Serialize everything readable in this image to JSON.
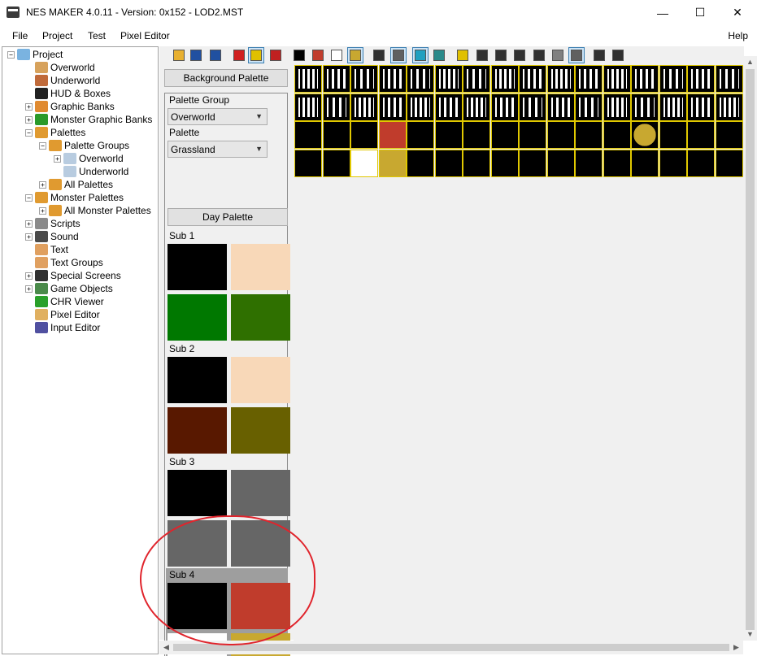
{
  "window": {
    "title": "NES MAKER 4.0.11 - Version: 0x152 - LOD2.MST",
    "min_glyph": "—",
    "max_glyph": "☐",
    "close_glyph": "✕"
  },
  "menu": {
    "items": [
      "File",
      "Project",
      "Test",
      "Pixel Editor"
    ],
    "help": "Help"
  },
  "tree": {
    "items": [
      {
        "label": "Project",
        "level": 0,
        "expander": "−",
        "icon": "project-icon",
        "color": "#7ab3e0"
      },
      {
        "label": "Overworld",
        "level": 1,
        "expander": "",
        "icon": "overworld-icon",
        "color": "#d7a25c"
      },
      {
        "label": "Underworld",
        "level": 1,
        "expander": "",
        "icon": "underworld-icon",
        "color": "#c06a3a"
      },
      {
        "label": "HUD & Boxes",
        "level": 1,
        "expander": "",
        "icon": "hud-icon",
        "color": "#222222"
      },
      {
        "label": "Graphic Banks",
        "level": 1,
        "expander": "+",
        "icon": "graphic-banks-icon",
        "color": "#e08a30"
      },
      {
        "label": "Monster Graphic Banks",
        "level": 1,
        "expander": "+",
        "icon": "monster-banks-icon",
        "color": "#2a9a2a"
      },
      {
        "label": "Palettes",
        "level": 1,
        "expander": "−",
        "icon": "palette-icon",
        "color": "#e09a30"
      },
      {
        "label": "Palette Groups",
        "level": 2,
        "expander": "−",
        "icon": "palette-icon",
        "color": "#e09a30"
      },
      {
        "label": "Overworld",
        "level": 3,
        "expander": "+",
        "icon": "doc-icon",
        "color": "#b8cce0"
      },
      {
        "label": "Underworld",
        "level": 3,
        "expander": "",
        "icon": "doc-icon",
        "color": "#b8cce0"
      },
      {
        "label": "All Palettes",
        "level": 2,
        "expander": "+",
        "icon": "palette-icon",
        "color": "#e09a30"
      },
      {
        "label": "Monster Palettes",
        "level": 1,
        "expander": "−",
        "icon": "palette-icon",
        "color": "#e09a30"
      },
      {
        "label": "All Monster Palettes",
        "level": 2,
        "expander": "+",
        "icon": "palette-icon",
        "color": "#e09a30"
      },
      {
        "label": "Scripts",
        "level": 1,
        "expander": "+",
        "icon": "scripts-icon",
        "color": "#8a8a8a"
      },
      {
        "label": "Sound",
        "level": 1,
        "expander": "+",
        "icon": "sound-icon",
        "color": "#4a4a4a"
      },
      {
        "label": "Text",
        "level": 1,
        "expander": "",
        "icon": "text-icon",
        "color": "#e0a060"
      },
      {
        "label": "Text Groups",
        "level": 1,
        "expander": "",
        "icon": "text-groups-icon",
        "color": "#e0a060"
      },
      {
        "label": "Special Screens",
        "level": 1,
        "expander": "+",
        "icon": "special-screens-icon",
        "color": "#303030"
      },
      {
        "label": "Game Objects",
        "level": 1,
        "expander": "+",
        "icon": "game-objects-icon",
        "color": "#4a8a4a"
      },
      {
        "label": "CHR Viewer",
        "level": 1,
        "expander": "",
        "icon": "chr-viewer-icon",
        "color": "#2aa02a"
      },
      {
        "label": "Pixel Editor",
        "level": 1,
        "expander": "",
        "icon": "pixel-editor-icon",
        "color": "#e0b060"
      },
      {
        "label": "Input Editor",
        "level": 1,
        "expander": "",
        "icon": "input-editor-icon",
        "color": "#5050a0"
      }
    ]
  },
  "palette_panel": {
    "background_palette_label": "Background Palette",
    "palette_group_label": "Palette Group",
    "palette_group_value": "Overworld",
    "palette_label": "Palette",
    "palette_value": "Grassland",
    "day_palette_label": "Day Palette",
    "subs": [
      {
        "label": "Sub 1",
        "colors": [
          "#000000",
          "#f8d8b8",
          "#007800",
          "#2f7000"
        ]
      },
      {
        "label": "Sub 2",
        "colors": [
          "#000000",
          "#f8d8b8",
          "#581800",
          "#686000"
        ]
      },
      {
        "label": "Sub 3",
        "colors": [
          "#000000",
          "#666666",
          "#666666",
          "#666666"
        ]
      },
      {
        "label": "Sub 4",
        "colors": [
          "#000000",
          "#c03c2c",
          "#ffffff",
          "#c8a830"
        ]
      }
    ]
  },
  "toolbar": {
    "buttons": [
      {
        "name": "open-folder-icon",
        "color": "#e8b030"
      },
      {
        "name": "save-icon",
        "color": "#2050a0"
      },
      {
        "name": "save-as-icon",
        "color": "#2050a0"
      },
      {
        "name": "rgb-palette-icon",
        "color": "#d02020"
      },
      {
        "name": "color-swap-icon",
        "color": "#e0c000"
      },
      {
        "name": "no-color-icon",
        "color": "#c02020"
      },
      {
        "name": "color-black-icon",
        "color": "#000000"
      },
      {
        "name": "color-red-icon",
        "color": "#c03c2c"
      },
      {
        "name": "color-white-icon",
        "color": "#ffffff"
      },
      {
        "name": "color-gold-icon",
        "color": "#c8a830"
      },
      {
        "name": "grid-icon",
        "color": "#303030"
      },
      {
        "name": "diagonal-line-icon",
        "color": "#606060"
      },
      {
        "name": "tile-number-icon",
        "color": "#20a0c0"
      },
      {
        "name": "tile-grid-icon",
        "color": "#2a8a8a"
      },
      {
        "name": "pencil-icon",
        "color": "#e0c000"
      },
      {
        "name": "select-icon",
        "color": "#303030"
      },
      {
        "name": "rectangle-icon",
        "color": "#303030"
      },
      {
        "name": "fill-rect-icon",
        "color": "#303030"
      },
      {
        "name": "line-icon",
        "color": "#303030"
      },
      {
        "name": "pattern-icon",
        "color": "#808080"
      },
      {
        "name": "checker-icon",
        "color": "#606060"
      },
      {
        "name": "zoom-in-icon",
        "color": "#303030"
      },
      {
        "name": "zoom-out-icon",
        "color": "#303030"
      }
    ]
  }
}
